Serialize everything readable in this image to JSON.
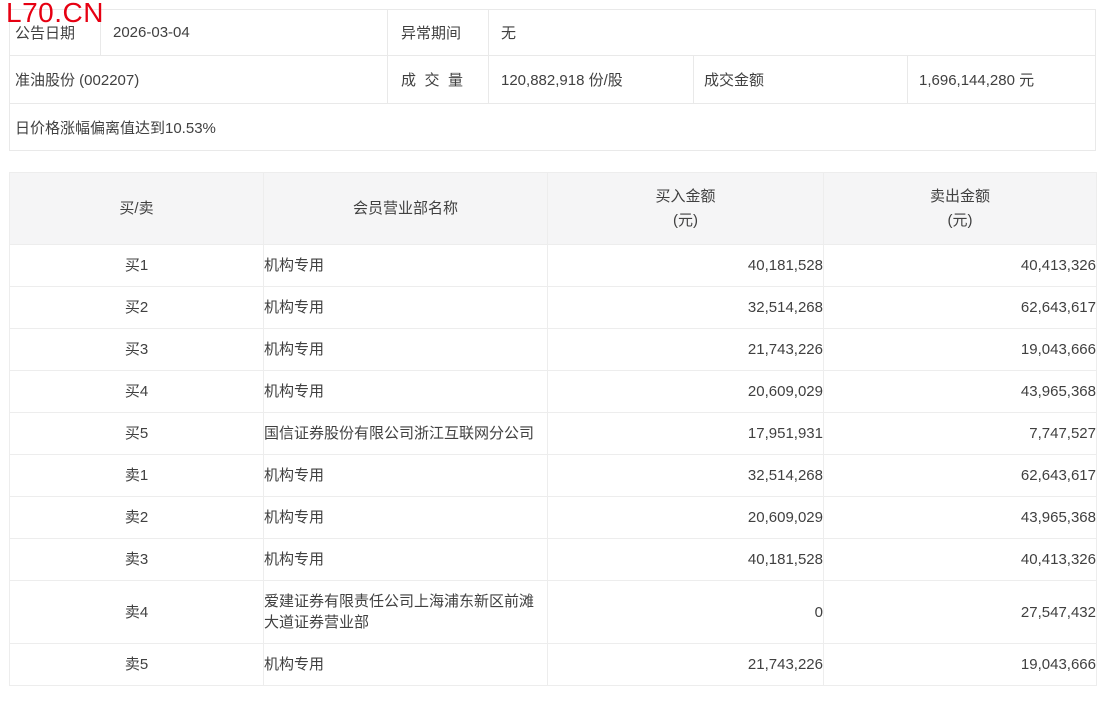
{
  "watermark": "L70.CN",
  "info": {
    "announce_date_label": "公告日期",
    "announce_date": "2026-03-04",
    "abnormal_period_label": "异常期间",
    "abnormal_period": "无",
    "stock": "准油股份 (002207)",
    "volume_label": "成交量",
    "volume": "120,882,918 份/股",
    "turnover_label": "成交金额",
    "turnover": "1,696,144,280 元",
    "reason": "日价格涨幅偏离值达到10.53%"
  },
  "table": {
    "headers": {
      "side": "买/卖",
      "branch": "会员营业部名称",
      "buy": "买入金额",
      "sell": "卖出金额",
      "unit": "(元)"
    },
    "rows": [
      {
        "side": "买1",
        "name": "机构专用",
        "buy": "40,181,528",
        "sell": "40,413,326"
      },
      {
        "side": "买2",
        "name": "机构专用",
        "buy": "32,514,268",
        "sell": "62,643,617"
      },
      {
        "side": "买3",
        "name": "机构专用",
        "buy": "21,743,226",
        "sell": "19,043,666"
      },
      {
        "side": "买4",
        "name": "机构专用",
        "buy": "20,609,029",
        "sell": "43,965,368"
      },
      {
        "side": "买5",
        "name": "国信证券股份有限公司浙江互联网分公司",
        "buy": "17,951,931",
        "sell": "7,747,527"
      },
      {
        "side": "卖1",
        "name": "机构专用",
        "buy": "32,514,268",
        "sell": "62,643,617"
      },
      {
        "side": "卖2",
        "name": "机构专用",
        "buy": "20,609,029",
        "sell": "43,965,368"
      },
      {
        "side": "卖3",
        "name": "机构专用",
        "buy": "40,181,528",
        "sell": "40,413,326"
      },
      {
        "side": "卖4",
        "name": "爱建证券有限责任公司上海浦东新区前滩大道证券营业部",
        "buy": "0",
        "sell": "27,547,432"
      },
      {
        "side": "卖5",
        "name": "机构专用",
        "buy": "21,743,226",
        "sell": "19,043,666"
      }
    ]
  },
  "colors": {
    "watermark_red": "#e60012",
    "panel_border": "#e9e9e9",
    "table_border": "#ededed",
    "header_bg": "#f5f5f6",
    "text": "#404040"
  }
}
